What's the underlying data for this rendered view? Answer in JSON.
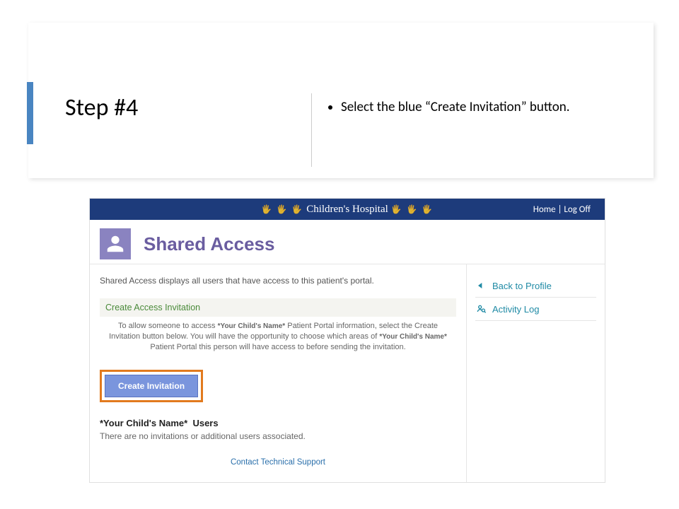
{
  "step": {
    "title": "Step #4",
    "bullet": "Select the blue “Create Invitation” button."
  },
  "portal": {
    "brand": "Children's Hospital",
    "nav": {
      "home": "Home",
      "sep": " | ",
      "logoff": "Log Off"
    },
    "page_title": "Shared Access",
    "intro": "Shared Access displays all users that have access to this patient's portal.",
    "invite": {
      "title": "Create Access Invitation",
      "body1": "To allow someone to access ",
      "ph1": "*Your Child's Name*",
      "body2": " Patient Portal information, select the Create Invitation button below. You will have the opportunity to choose which areas of ",
      "ph2": "*Your Child's Name*",
      "body3": " Patient Portal this person will have access to before sending the invitation.",
      "button": "Create Invitation"
    },
    "users": {
      "ph": "*Your Child's Name*",
      "word": "Users",
      "empty": "There are no invitations or additional users associated."
    },
    "support": "Contact Technical Support",
    "side": {
      "back": "Back to Profile",
      "activity": "Activity Log"
    }
  }
}
